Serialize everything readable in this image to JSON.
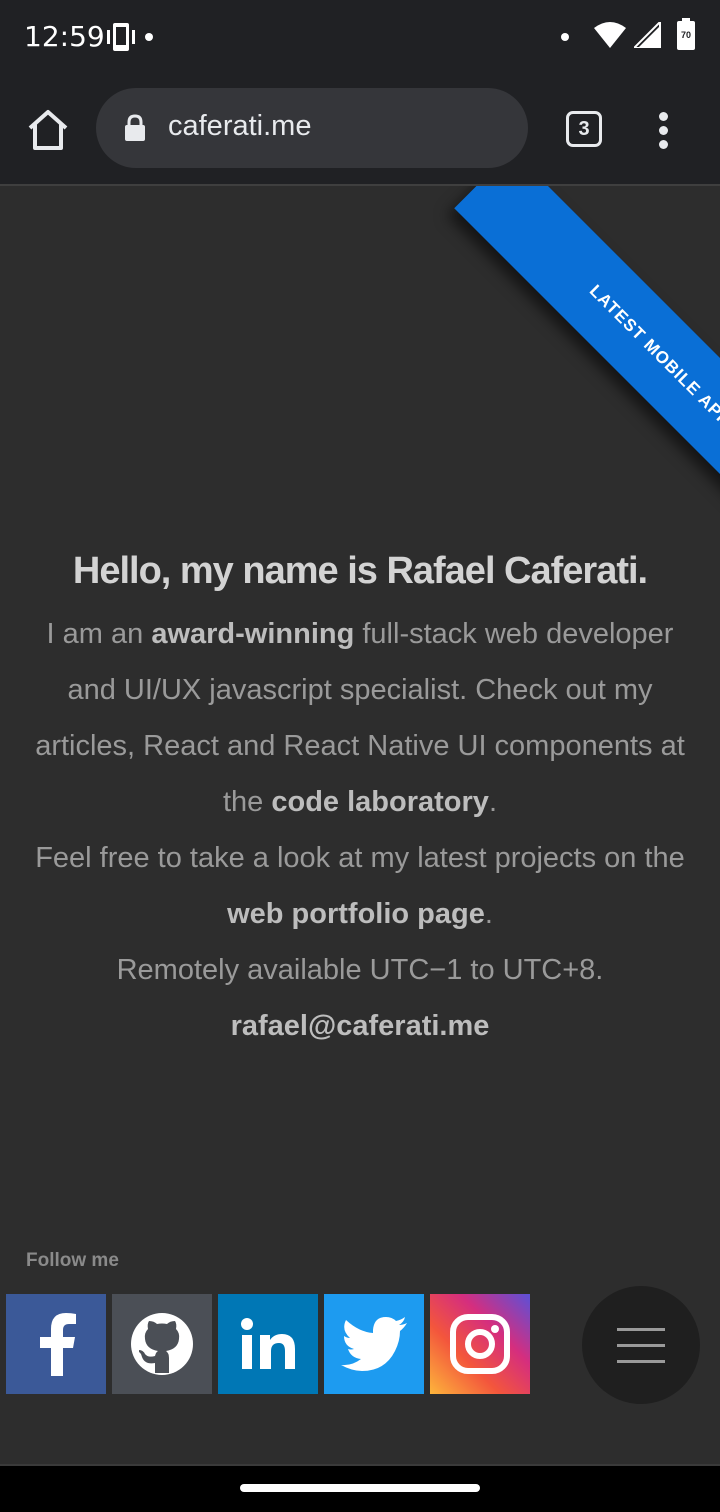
{
  "status_bar": {
    "time": "12:59",
    "battery_level": "70",
    "icons": [
      "vibrate-icon",
      "notification-dot-icon",
      "wifi-icon",
      "cell-signal-icon",
      "battery-icon"
    ]
  },
  "browser": {
    "url": "caferati.me",
    "tab_count": "3"
  },
  "ribbon": {
    "label": "Latest Mobile App",
    "color": "#0a6fd6"
  },
  "intro": {
    "heading": "Hello, my name is Rafael Caferati.",
    "p1_a": "I am an ",
    "p1_award": "award-winning",
    "p1_b": " full-stack web developer and UI/UX javascript specialist. Check out my articles, React and React Native UI components at the ",
    "p1_link": "code laboratory",
    "p1_c": ".",
    "p2_a": "Feel free to take a look at my latest projects on the ",
    "p2_link": "web portfolio page",
    "p2_b": ".",
    "p3": "Remotely available UTC−1 to UTC+8.",
    "email": "rafael@caferati.me"
  },
  "footer": {
    "follow_label": "Follow me",
    "social": [
      {
        "name": "facebook",
        "color": "#3b5998"
      },
      {
        "name": "github",
        "color": "#4b4f56"
      },
      {
        "name": "linkedin",
        "color": "#0077b5"
      },
      {
        "name": "twitter",
        "color": "#1d9bf0"
      },
      {
        "name": "instagram",
        "color": "#d52e7e"
      }
    ]
  }
}
